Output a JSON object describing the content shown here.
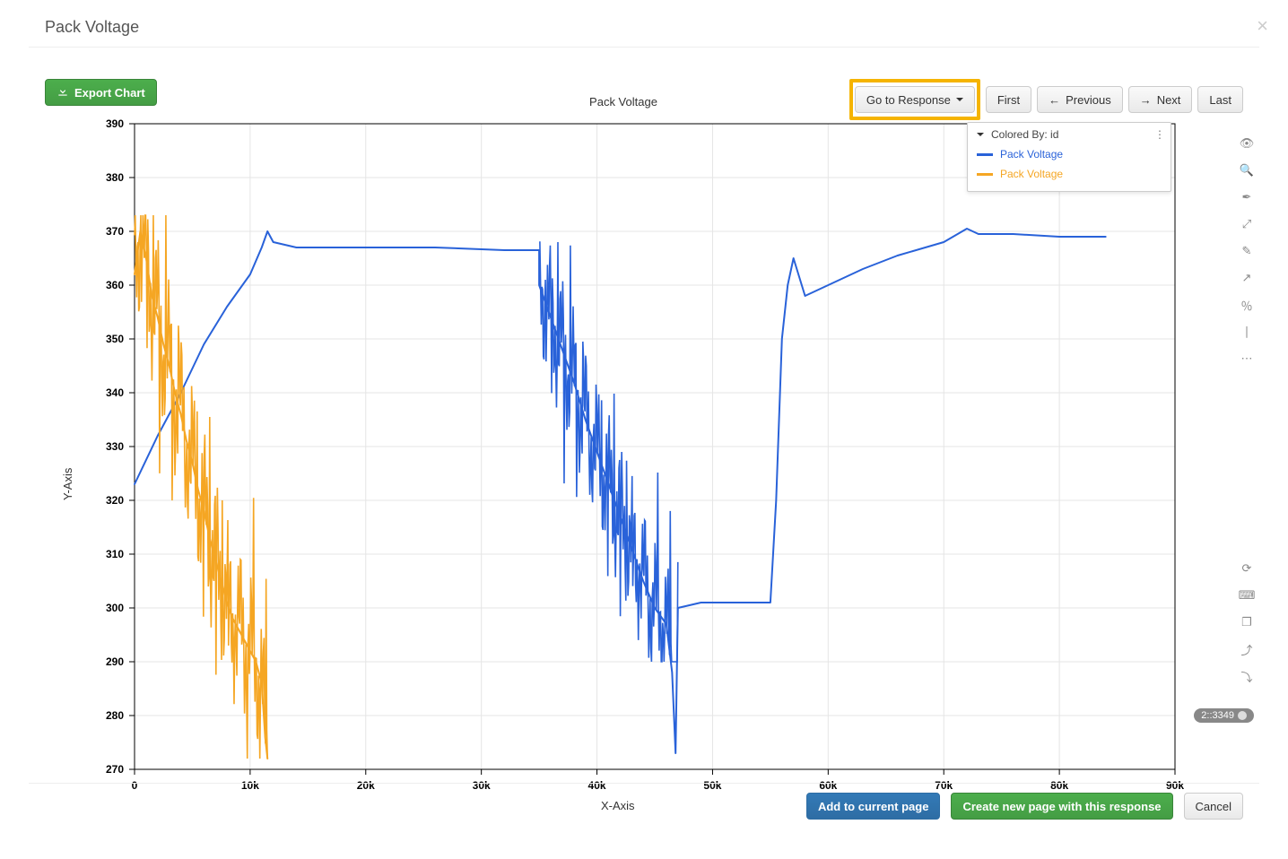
{
  "modal_title": "Pack Voltage",
  "toolbar": {
    "export_label": "Export Chart"
  },
  "nav": {
    "goto_label": "Go to Response",
    "first": "First",
    "previous": "Previous",
    "next": "Next",
    "last": "Last"
  },
  "footer": {
    "add_current": "Add to current page",
    "create_new": "Create new page with this response",
    "cancel": "Cancel"
  },
  "badge_text": "2::3349",
  "chart_data": {
    "type": "line",
    "title": "Pack Voltage",
    "xlabel": "X-Axis",
    "ylabel": "Y-Axis",
    "xlim": [
      0,
      90000
    ],
    "ylim": [
      270,
      390
    ],
    "x_ticks": [
      0,
      10000,
      20000,
      30000,
      40000,
      50000,
      60000,
      70000,
      80000,
      90000
    ],
    "x_tick_labels": [
      "0",
      "10k",
      "20k",
      "30k",
      "40k",
      "50k",
      "60k",
      "70k",
      "80k",
      "90k"
    ],
    "y_ticks": [
      270,
      280,
      290,
      300,
      310,
      320,
      330,
      340,
      350,
      360,
      370,
      380,
      390
    ],
    "legend_title": "Colored By: id",
    "series": [
      {
        "name": "Pack Voltage",
        "color": "#2962d9",
        "noise_segments": [
          {
            "x_range": [
              35000,
              47000
            ],
            "band": [
              290,
              368
            ],
            "trend": "down",
            "amplitude": 14
          }
        ],
        "baseline": [
          [
            0,
            323
          ],
          [
            2000,
            332
          ],
          [
            4000,
            340
          ],
          [
            6000,
            349
          ],
          [
            8000,
            356
          ],
          [
            10000,
            362
          ],
          [
            11000,
            367
          ],
          [
            11500,
            370
          ],
          [
            12000,
            368
          ],
          [
            14000,
            367
          ],
          [
            20000,
            367
          ],
          [
            26000,
            367
          ],
          [
            32000,
            366.5
          ],
          [
            35000,
            366.5
          ],
          [
            35000,
            360
          ],
          [
            36000,
            354
          ],
          [
            37000,
            348
          ],
          [
            38000,
            342
          ],
          [
            39000,
            335
          ],
          [
            40000,
            329
          ],
          [
            41000,
            323
          ],
          [
            42000,
            317
          ],
          [
            43000,
            311
          ],
          [
            44000,
            305
          ],
          [
            45000,
            300
          ],
          [
            46000,
            297
          ],
          [
            46500,
            288
          ],
          [
            46800,
            273
          ],
          [
            47000,
            300
          ],
          [
            49000,
            301
          ],
          [
            52000,
            301
          ],
          [
            55000,
            301
          ],
          [
            55500,
            320
          ],
          [
            56000,
            350
          ],
          [
            56500,
            360
          ],
          [
            57000,
            365
          ],
          [
            58000,
            358
          ],
          [
            60000,
            360
          ],
          [
            63000,
            363
          ],
          [
            66000,
            365.5
          ],
          [
            70000,
            368
          ],
          [
            72000,
            370.5
          ],
          [
            73000,
            369.5
          ],
          [
            76000,
            369.5
          ],
          [
            80000,
            369
          ],
          [
            84000,
            369
          ]
        ]
      },
      {
        "name": "Pack Voltage",
        "color": "#f5a623",
        "noise_segments": [
          {
            "x_range": [
              0,
              11500
            ],
            "band": [
              272,
              373
            ],
            "trend": "down",
            "amplitude": 16
          }
        ],
        "baseline": [
          [
            0,
            362
          ],
          [
            500,
            370
          ],
          [
            1000,
            365
          ],
          [
            1500,
            358
          ],
          [
            2000,
            354
          ],
          [
            2500,
            349
          ],
          [
            3000,
            345
          ],
          [
            3500,
            340
          ],
          [
            4000,
            336
          ],
          [
            4500,
            331
          ],
          [
            5000,
            327
          ],
          [
            5500,
            322
          ],
          [
            6000,
            318
          ],
          [
            6500,
            313
          ],
          [
            7000,
            309
          ],
          [
            7500,
            305
          ],
          [
            8000,
            301
          ],
          [
            8500,
            298
          ],
          [
            9000,
            296
          ],
          [
            9500,
            294
          ],
          [
            10000,
            292
          ],
          [
            10500,
            290
          ],
          [
            11000,
            286
          ],
          [
            11300,
            276
          ],
          [
            11500,
            272
          ]
        ]
      }
    ]
  },
  "tool_icons_top": [
    "eye-icon",
    "zoom-icon",
    "eyedropper-icon",
    "expand-icon",
    "pencil-icon",
    "arrow-upright-icon",
    "percent-icon",
    "vbar-icon",
    "more-icon"
  ],
  "tool_icons_bottom": [
    "refresh-icon",
    "keyboard-icon",
    "copy-icon",
    "upload-icon",
    "download-icon"
  ]
}
